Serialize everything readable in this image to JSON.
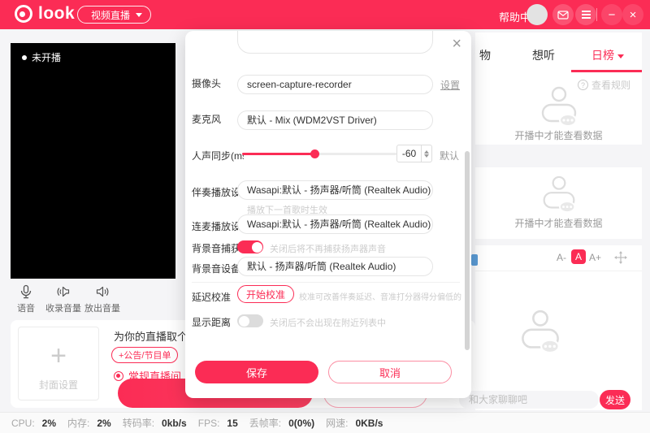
{
  "colors": {
    "brand": "#fb2c55",
    "page_bg": "#f5f5f7"
  },
  "header": {
    "logo_text": "look",
    "category_pill": "视频直播",
    "help_center": "帮助中心",
    "menu_glyph": "≡",
    "minimize_glyph": "−",
    "close_glyph": "×"
  },
  "left_panel": {
    "live_badge": "未开播",
    "voice_label": "语音",
    "record_volume_label": "收录音量",
    "output_volume_label": "放出音量",
    "cover_plus_glyph": "+",
    "cover_label": "封面设置",
    "room_title_text": "为你的直播取个",
    "announcement_pill": "+公告/节目单",
    "room_type_label": "常规直播间"
  },
  "modal": {
    "close_glyph": "×",
    "camera": {
      "label": "摄像头",
      "value": "screen-capture-recorder",
      "action": "设置"
    },
    "microphone": {
      "label": "麦克风",
      "value": "默认 - Mix (WDM2VST Driver)"
    },
    "voice_sync": {
      "label": "人声同步(ms)",
      "value": "-60",
      "default_label": "默认",
      "percent": 47
    },
    "accompaniment_device": {
      "label": "伴奏播放设备",
      "value": "Wasapi:默认 - 扬声器/听筒 (Realtek Audio)",
      "hint": "播放下一首歌时生效"
    },
    "connect_device": {
      "label": "连麦播放设备",
      "value": "Wasapi:默认 - 扬声器/听筒 (Realtek Audio)"
    },
    "bg_capture": {
      "label": "背景音捕获",
      "hint": "关闭后将不再捕获扬声器声音",
      "state": "on"
    },
    "bg_device": {
      "label": "背景音设备",
      "value": "默认 - 扬声器/听筒 (Realtek Audio)"
    },
    "latency": {
      "label": "延迟校准",
      "button": "开始校准",
      "hint": "校准可改善伴奏延迟、音准打分器得分偏低的问题"
    },
    "distance": {
      "label": "显示距离",
      "hint": "关闭后不会出现在附近列表中",
      "state": "off"
    },
    "save_label": "保存",
    "cancel_label": "取消"
  },
  "right_panel": {
    "tabs": [
      {
        "label": "物"
      },
      {
        "label": "想听"
      },
      {
        "label": "日榜"
      }
    ],
    "active_tab": "日榜",
    "rules_icon_glyph": "?",
    "rules_link": "查看规则",
    "empty_text": "开播中才能查看数据",
    "font_minus": "A-",
    "font_current": "A",
    "font_plus": "A+",
    "chat_placeholder": "和大家聊聊吧",
    "send_label": "发送"
  },
  "status_bar": {
    "items": [
      {
        "label": "CPU:",
        "value": "2%"
      },
      {
        "label": "内存:",
        "value": "2%"
      },
      {
        "label": "转码率:",
        "value": "0kb/s"
      },
      {
        "label": "FPS:",
        "value": "15"
      },
      {
        "label": "丢帧率:",
        "value": "0(0%)"
      },
      {
        "label": "网速:",
        "value": "0KB/s"
      }
    ]
  }
}
